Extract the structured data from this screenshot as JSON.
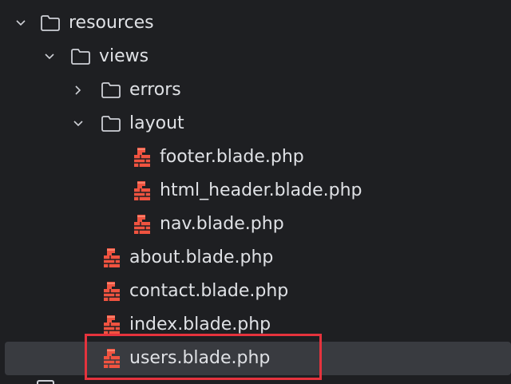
{
  "tree": {
    "resources": {
      "label": "resources",
      "icon": "folder-icon",
      "chevron": "chevron-down-icon"
    },
    "views": {
      "label": "views",
      "icon": "folder-icon",
      "chevron": "chevron-down-icon"
    },
    "errors": {
      "label": "errors",
      "icon": "folder-icon",
      "chevron": "chevron-right-icon"
    },
    "layout": {
      "label": "layout",
      "icon": "folder-icon",
      "chevron": "chevron-down-icon"
    },
    "files": {
      "footer": "footer.blade.php",
      "html_header": "html_header.blade.php",
      "nav": "nav.blade.php",
      "about": "about.blade.php",
      "contact": "contact.blade.php",
      "index": "index.blade.php",
      "users": "users.blade.php"
    },
    "selected": "users.blade.php"
  },
  "colors": {
    "background": "#1e1f22",
    "text": "#dfe1e5",
    "selection": "#393b40",
    "highlight_border": "#e5333d",
    "blade_icon": "#f05340"
  }
}
